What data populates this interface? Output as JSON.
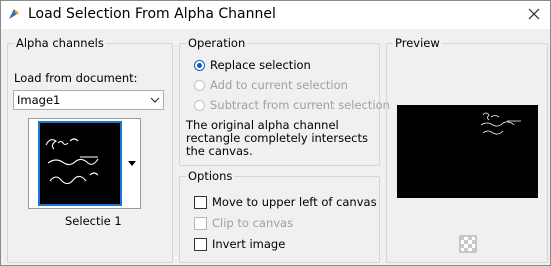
{
  "window": {
    "title": "Load Selection From Alpha Channel"
  },
  "alpha_channels": {
    "legend": "Alpha channels",
    "load_label": "Load from document:",
    "document_value": "Image1",
    "selection_name": "Selectie 1"
  },
  "operation": {
    "legend": "Operation",
    "options": [
      {
        "label": "Replace selection",
        "selected": true,
        "enabled": true
      },
      {
        "label": "Add to current selection",
        "selected": false,
        "enabled": false
      },
      {
        "label": "Subtract from current selection",
        "selected": false,
        "enabled": false
      }
    ],
    "note": "The original alpha channel rectangle completely intersects the canvas."
  },
  "options": {
    "legend": "Options",
    "items": [
      {
        "label": "Move to upper left of canvas",
        "checked": false,
        "enabled": true
      },
      {
        "label": "Clip to canvas",
        "checked": false,
        "enabled": false
      },
      {
        "label": "Invert image",
        "checked": false,
        "enabled": true
      }
    ]
  },
  "preview": {
    "legend": "Preview"
  },
  "colors": {
    "accent": "#0a5fc2",
    "thumb_border": "#1a74d8",
    "preview_bg": "#000000"
  }
}
